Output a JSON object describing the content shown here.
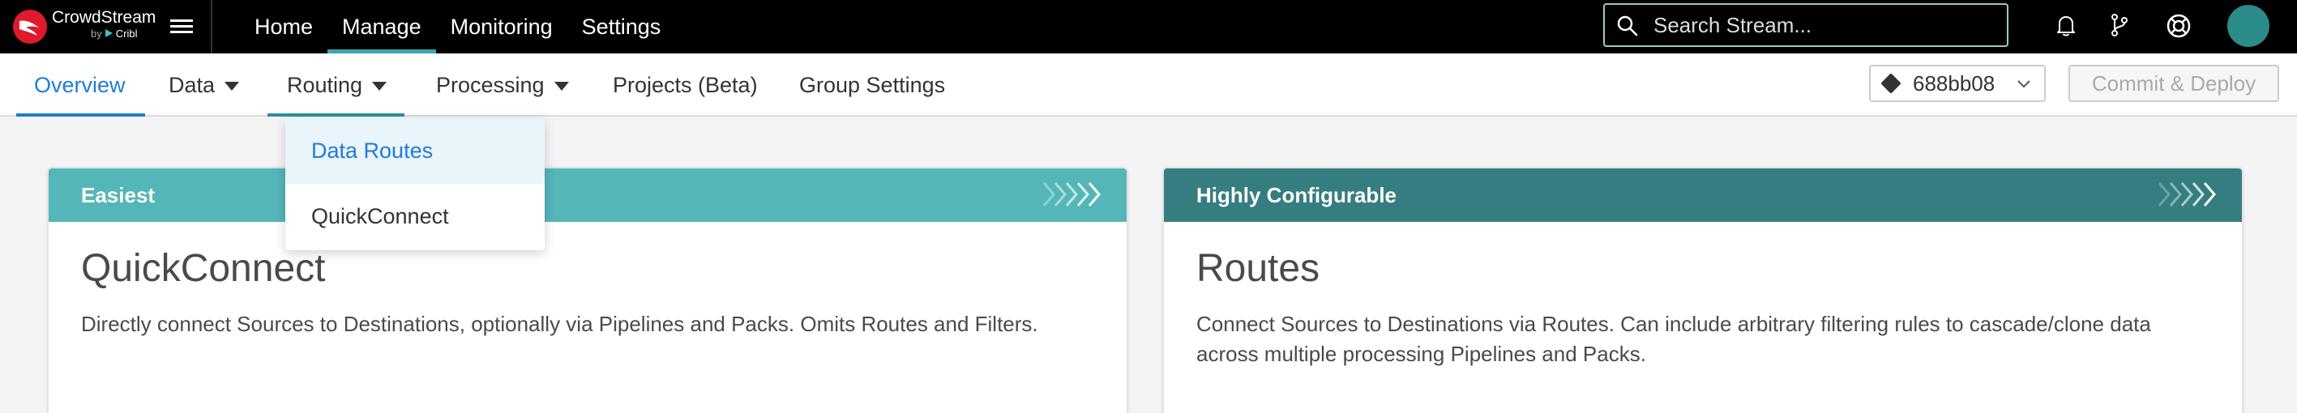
{
  "brand": {
    "name": "CrowdStream",
    "by": "by",
    "sub": "Cribl"
  },
  "topnav": [
    "Home",
    "Manage",
    "Monitoring",
    "Settings"
  ],
  "search": {
    "placeholder": "Search Stream..."
  },
  "subnav": {
    "overview": "Overview",
    "data": "Data",
    "routing": "Routing",
    "processing": "Processing",
    "projects": "Projects (Beta)",
    "group_settings": "Group Settings"
  },
  "commit": {
    "hash": "688bb08",
    "deploy_label": "Commit & Deploy"
  },
  "dropdown": {
    "items": [
      "Data Routes",
      "QuickConnect"
    ]
  },
  "cards": [
    {
      "tag": "Easiest",
      "title": "QuickConnect",
      "desc": "Directly connect Sources to Destinations, optionally via Pipelines and Packs. Omits Routes and Filters.",
      "color": "#55b6b8"
    },
    {
      "tag": "Highly Configurable",
      "title": "Routes",
      "desc": "Connect Sources to Destinations via Routes. Can include arbitrary filtering rules to cascade/clone data across multiple processing Pipelines and Packs.",
      "color": "#367d80"
    }
  ],
  "colors": {
    "accent": "#1f7dd6",
    "topbar": "#000000",
    "avatar": "#2b8b89",
    "logo": "#e01a2b"
  }
}
